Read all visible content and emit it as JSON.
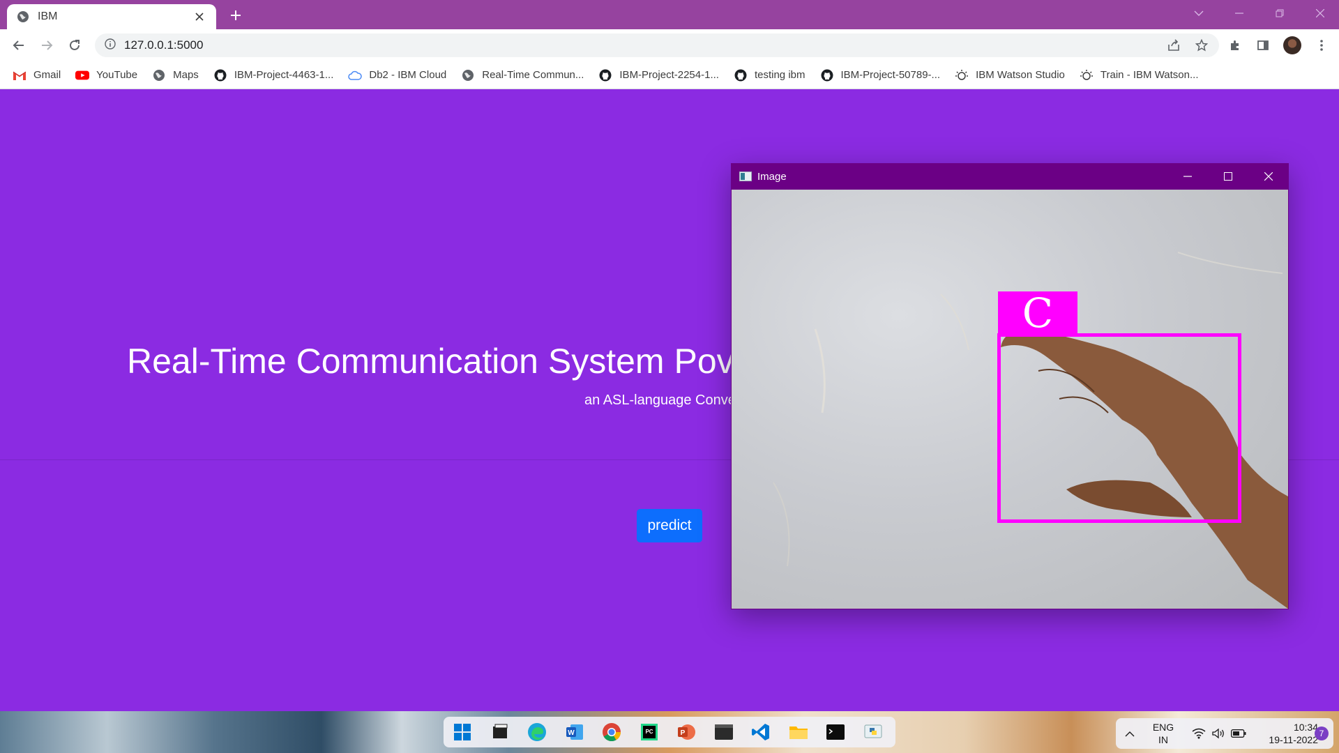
{
  "browser": {
    "tab_title": "IBM",
    "url": "127.0.0.1:5000"
  },
  "bookmarks": [
    {
      "label": "Gmail",
      "icon": "gmail-icon"
    },
    {
      "label": "YouTube",
      "icon": "youtube-icon"
    },
    {
      "label": "Maps",
      "icon": "globe-icon"
    },
    {
      "label": "IBM-Project-4463-1...",
      "icon": "github-icon"
    },
    {
      "label": "Db2 - IBM Cloud",
      "icon": "cloud-icon"
    },
    {
      "label": "Real-Time Commun...",
      "icon": "globe-icon"
    },
    {
      "label": "IBM-Project-2254-1...",
      "icon": "github-icon"
    },
    {
      "label": "testing ibm",
      "icon": "github-icon"
    },
    {
      "label": "IBM-Project-50789-...",
      "icon": "github-icon"
    },
    {
      "label": "IBM Watson Studio",
      "icon": "watson-icon"
    },
    {
      "label": "Train - IBM Watson...",
      "icon": "watson-icon"
    }
  ],
  "page": {
    "title": "Real-Time Communication System Pov",
    "subtitle": "an ASL-language Conve",
    "predict_label": "predict",
    "background": "#8b2be2",
    "button_color": "#0d6efd"
  },
  "image_window": {
    "title": "Image",
    "predicted_letter": "C",
    "box_color": "#ff00ff",
    "titlebar_color": "#6b0085"
  },
  "taskbar": {
    "language_line1": "ENG",
    "language_line2": "IN",
    "time": "10:34",
    "date": "19-11-2022",
    "notification_count": "7",
    "apps": [
      "start-icon",
      "file-explorer-icon",
      "edge-icon",
      "word-icon",
      "chrome-icon",
      "pycharm-icon",
      "powerpoint-icon",
      "terminal-icon",
      "vscode-icon",
      "folder-icon",
      "cmd-icon",
      "python-icon"
    ]
  }
}
